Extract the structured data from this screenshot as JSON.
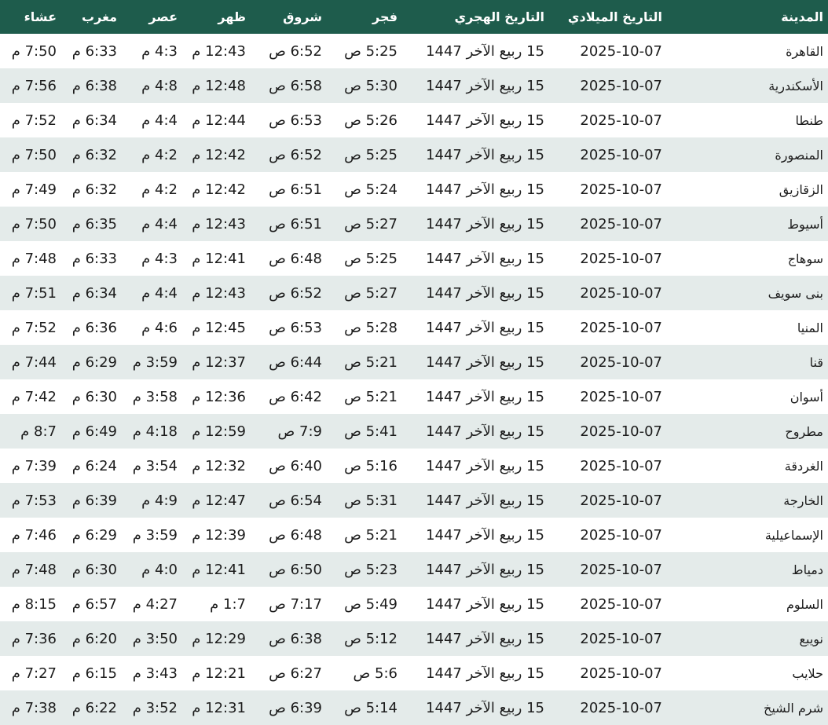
{
  "headers": [
    "المدينة",
    "التاريخ الميلادي",
    "التاريخ الهجري",
    "فجر",
    "شروق",
    "ظهر",
    "عصر",
    "مغرب",
    "عشاء"
  ],
  "rows": [
    [
      "القاهرة",
      "2025-10-07",
      "15 ربيع الآخر 1447",
      "5:25 ص",
      "6:52 ص",
      "12:43 م",
      "4:3 م",
      "6:33 م",
      "7:50 م"
    ],
    [
      "الأسكندرية",
      "2025-10-07",
      "15 ربيع الآخر 1447",
      "5:30 ص",
      "6:58 ص",
      "12:48 م",
      "4:8 م",
      "6:38 م",
      "7:56 م"
    ],
    [
      "طنطا",
      "2025-10-07",
      "15 ربيع الآخر 1447",
      "5:26 ص",
      "6:53 ص",
      "12:44 م",
      "4:4 م",
      "6:34 م",
      "7:52 م"
    ],
    [
      "المنصورة",
      "2025-10-07",
      "15 ربيع الآخر 1447",
      "5:25 ص",
      "6:52 ص",
      "12:42 م",
      "4:2 م",
      "6:32 م",
      "7:50 م"
    ],
    [
      "الزقازيق",
      "2025-10-07",
      "15 ربيع الآخر 1447",
      "5:24 ص",
      "6:51 ص",
      "12:42 م",
      "4:2 م",
      "6:32 م",
      "7:49 م"
    ],
    [
      "أسيوط",
      "2025-10-07",
      "15 ربيع الآخر 1447",
      "5:27 ص",
      "6:51 ص",
      "12:43 م",
      "4:4 م",
      "6:35 م",
      "7:50 م"
    ],
    [
      "سوهاج",
      "2025-10-07",
      "15 ربيع الآخر 1447",
      "5:25 ص",
      "6:48 ص",
      "12:41 م",
      "4:3 م",
      "6:33 م",
      "7:48 م"
    ],
    [
      "بنى سويف",
      "2025-10-07",
      "15 ربيع الآخر 1447",
      "5:27 ص",
      "6:52 ص",
      "12:43 م",
      "4:4 م",
      "6:34 م",
      "7:51 م"
    ],
    [
      "المنيا",
      "2025-10-07",
      "15 ربيع الآخر 1447",
      "5:28 ص",
      "6:53 ص",
      "12:45 م",
      "4:6 م",
      "6:36 م",
      "7:52 م"
    ],
    [
      "قنا",
      "2025-10-07",
      "15 ربيع الآخر 1447",
      "5:21 ص",
      "6:44 ص",
      "12:37 م",
      "3:59 م",
      "6:29 م",
      "7:44 م"
    ],
    [
      "أسوان",
      "2025-10-07",
      "15 ربيع الآخر 1447",
      "5:21 ص",
      "6:42 ص",
      "12:36 م",
      "3:58 م",
      "6:30 م",
      "7:42 م"
    ],
    [
      "مطروح",
      "2025-10-07",
      "15 ربيع الآخر 1447",
      "5:41 ص",
      "7:9 ص",
      "12:59 م",
      "4:18 م",
      "6:49 م",
      "8:7 م"
    ],
    [
      "الغردقة",
      "2025-10-07",
      "15 ربيع الآخر 1447",
      "5:16 ص",
      "6:40 ص",
      "12:32 م",
      "3:54 م",
      "6:24 م",
      "7:39 م"
    ],
    [
      "الخارجة",
      "2025-10-07",
      "15 ربيع الآخر 1447",
      "5:31 ص",
      "6:54 ص",
      "12:47 م",
      "4:9 م",
      "6:39 م",
      "7:53 م"
    ],
    [
      "الإسماعيلية",
      "2025-10-07",
      "15 ربيع الآخر 1447",
      "5:21 ص",
      "6:48 ص",
      "12:39 م",
      "3:59 م",
      "6:29 م",
      "7:46 م"
    ],
    [
      "دمياط",
      "2025-10-07",
      "15 ربيع الآخر 1447",
      "5:23 ص",
      "6:50 ص",
      "12:41 م",
      "4:0 م",
      "6:30 م",
      "7:48 م"
    ],
    [
      "السلوم",
      "2025-10-07",
      "15 ربيع الآخر 1447",
      "5:49 ص",
      "7:17 ص",
      "1:7 م",
      "4:27 م",
      "6:57 م",
      "8:15 م"
    ],
    [
      "نويبع",
      "2025-10-07",
      "15 ربيع الآخر 1447",
      "5:12 ص",
      "6:38 ص",
      "12:29 م",
      "3:50 م",
      "6:20 م",
      "7:36 م"
    ],
    [
      "حلايب",
      "2025-10-07",
      "15 ربيع الآخر 1447",
      "5:6 ص",
      "6:27 ص",
      "12:21 م",
      "3:43 م",
      "6:15 م",
      "7:27 م"
    ],
    [
      "شرم الشيخ",
      "2025-10-07",
      "15 ربيع الآخر 1447",
      "5:14 ص",
      "6:39 ص",
      "12:31 م",
      "3:52 م",
      "6:22 م",
      "7:38 م"
    ]
  ],
  "colors": {
    "header_bg": "#1e5c4c",
    "header_text": "#ffffff",
    "row_alt_bg": "#e4ebea",
    "row_bg": "#ffffff"
  }
}
